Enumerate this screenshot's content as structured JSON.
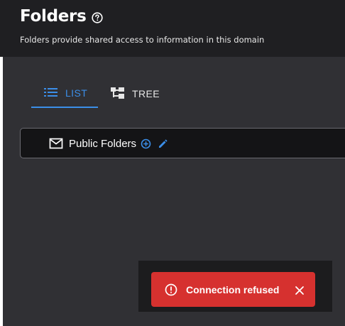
{
  "header": {
    "title": "Folders",
    "help_icon": "help-circle-icon",
    "subtitle": "Folders provide shared access to information in this domain"
  },
  "tabs": [
    {
      "label": "LIST",
      "icon": "list-icon",
      "active": true
    },
    {
      "label": "TREE",
      "icon": "tree-icon",
      "active": false
    }
  ],
  "folders": [
    {
      "name": "Public Folders",
      "icon": "mail-icon",
      "actions": [
        "add-circle-icon",
        "edit-pencil-icon"
      ]
    }
  ],
  "toast": {
    "message": "Connection refused",
    "icon": "error-circle-icon",
    "close_icon": "close-icon"
  },
  "colors": {
    "accent": "#3b8ee8",
    "error": "#d6312f",
    "header_bg": "#1f1f22",
    "panel_bg": "#303034"
  }
}
